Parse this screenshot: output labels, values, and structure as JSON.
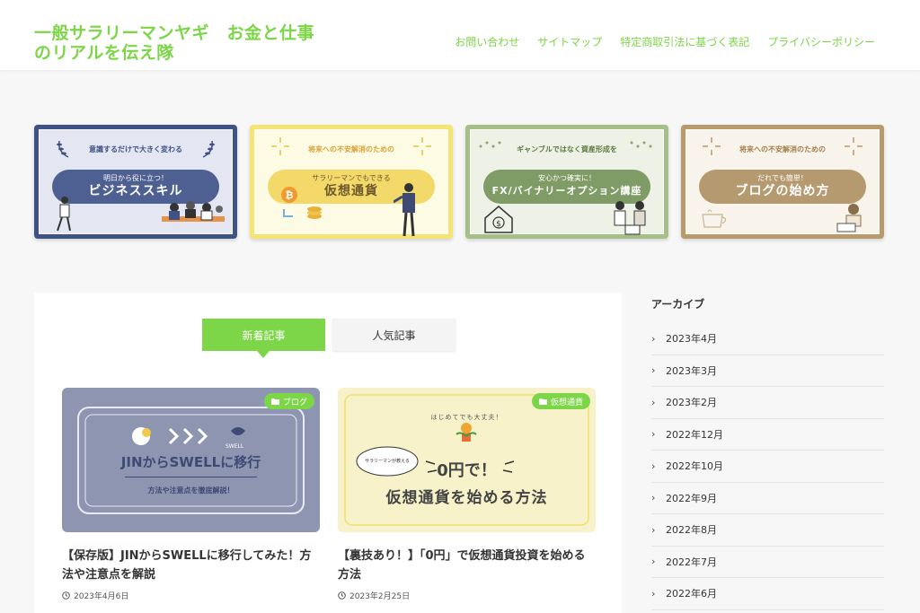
{
  "header": {
    "title_line1": "一般サラリーマンヤギ　お金と仕事",
    "title_line2": "のリアルを伝え隊",
    "nav": [
      "お問い合わせ",
      "サイトマップ",
      "特定商取引法に基づく表記",
      "プライバシーポリシー"
    ]
  },
  "banners": [
    {
      "tagline": "意識するだけで大きく変わる",
      "sub": "明日から役に立つ！",
      "main": "ビジネススキル"
    },
    {
      "tagline": "将来への不安解消のための",
      "sub": "サラリーマンでもできる",
      "main": "仮想通貨"
    },
    {
      "tagline": "ギャンブルではなく資産形成を",
      "sub": "安心かつ確実に！",
      "main": "FX/バイナリーオプション講座"
    },
    {
      "tagline": "将来への不安解消のための",
      "sub": "だれでも簡単！",
      "main": "ブログの始め方"
    }
  ],
  "tabs": {
    "new": "新着記事",
    "popular": "人気記事"
  },
  "posts": [
    {
      "category": "ブログ",
      "thumb_main": "JINからSWELLに移行",
      "thumb_sub": "方法や注意点を徹底解説！",
      "thumb_logo_right": "SWELL",
      "title": "【保存版】JINからSWELLに移行してみた！方法や注意点を解説",
      "date": "2023年4月6日"
    },
    {
      "category": "仮想通貨",
      "thumb_arc": "はじめてでも大丈夫！",
      "thumb_bubble": "サラリーマンが教える",
      "thumb_main1": "0円で！",
      "thumb_main2": "仮想通貨を始める方法",
      "title": "【裏技あり！】「0円」で仮想通貨投資を始める方法",
      "date": "2023年2月25日"
    }
  ],
  "sidebar": {
    "title": "アーカイブ",
    "archives": [
      "2023年4月",
      "2023年3月",
      "2023年2月",
      "2022年12月",
      "2022年10月",
      "2022年9月",
      "2022年8月",
      "2022年7月",
      "2022年6月"
    ]
  },
  "colors": {
    "accent": "#7dd548",
    "text": "#333333",
    "bg": "#f7f7f7"
  },
  "icons": {
    "folder": "folder-icon",
    "clock": "clock-icon",
    "chevron": "chevron-right-icon"
  }
}
